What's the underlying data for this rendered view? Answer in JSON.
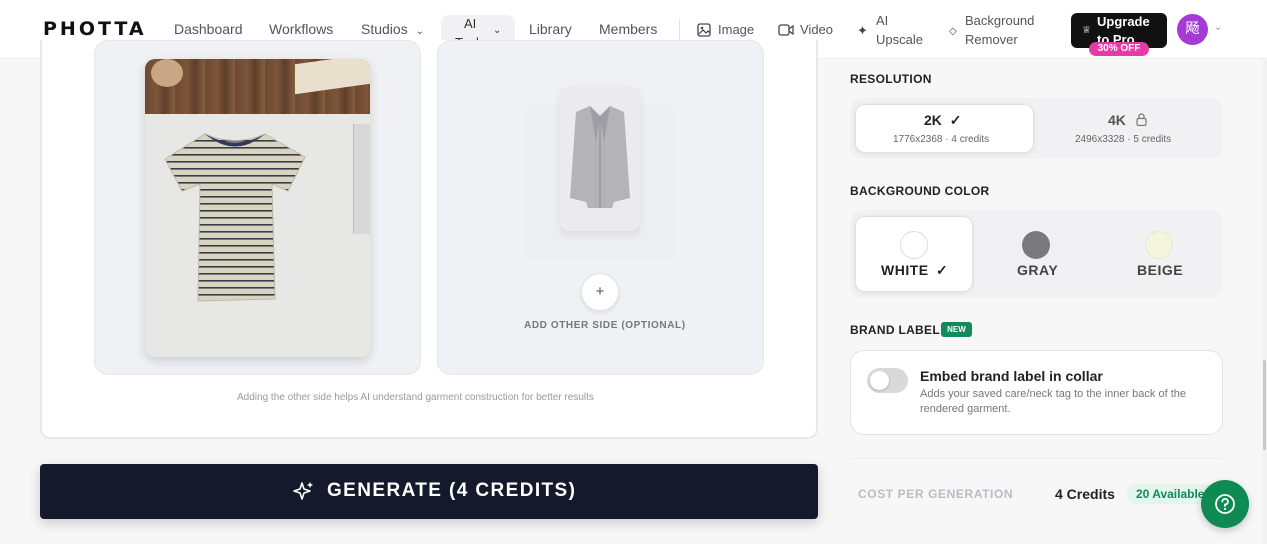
{
  "header": {
    "logo": "PHOTTA",
    "nav": [
      "Dashboard",
      "Workflows",
      "Studios",
      "Library",
      "Members"
    ],
    "ai_tools": {
      "line1": "AI",
      "line2": "Tools"
    },
    "tools": {
      "image": "Image",
      "video": "Video",
      "upscale": {
        "line1": "AI",
        "line2": "Upscale"
      },
      "bg_remover": {
        "line1": "Background",
        "line2": "Remover"
      }
    },
    "upgrade": {
      "line1": "Upgrade",
      "line2": "to Pro",
      "badge": "30% OFF"
    },
    "avatar_initial": "飏"
  },
  "upload": {
    "add_other_side": "ADD OTHER SIDE (OPTIONAL)",
    "plus": "+",
    "helper_text": "Adding the other side helps AI understand garment construction for better results"
  },
  "generate": {
    "label": "GENERATE (4 CREDITS)"
  },
  "resolution": {
    "title": "RESOLUTION",
    "options": [
      {
        "label": "2K",
        "check": "✓",
        "sub": "1776x2368 · 4 credits"
      },
      {
        "label": "4K",
        "sub": "2496x3328 · 5 credits"
      }
    ]
  },
  "background": {
    "title": "BACKGROUND COLOR",
    "options": [
      {
        "label": "WHITE",
        "check": "✓",
        "color": "#ffffff"
      },
      {
        "label": "GRAY",
        "color": "#7a7a7d"
      },
      {
        "label": "BEIGE",
        "color": "#f3f5dc"
      }
    ]
  },
  "brand_label": {
    "title": "BRAND LABEL",
    "badge": "NEW",
    "heading": "Embed brand label in collar",
    "description": "Adds your saved care/neck tag to the inner back of the rendered garment.",
    "enabled": false
  },
  "cost": {
    "label": "COST PER GENERATION",
    "value": "4 Credits",
    "available": "20 Available"
  },
  "colors": {
    "accent_green": "#0f8a52",
    "dark_button": "#141a2b",
    "pink": "#e63aa7",
    "avatar": "#a63ad6"
  }
}
